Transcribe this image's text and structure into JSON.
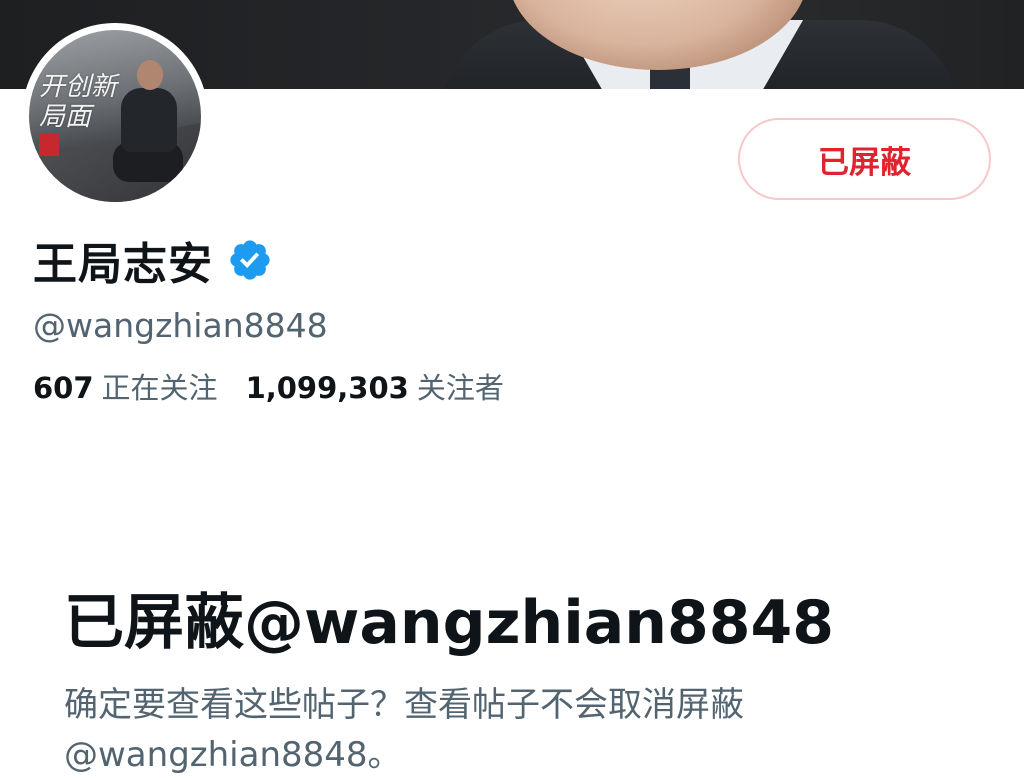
{
  "profile": {
    "display_name": "王局志安",
    "handle": "@wangzhian8848",
    "verified_icon": "verified-badge-icon",
    "avatar_text": "开创新局面",
    "blocked_button_label": "已屏蔽",
    "following_count": "607",
    "following_label": "正在关注",
    "followers_count": "1,099,303",
    "followers_label": "关注者"
  },
  "notice": {
    "title": "已屏蔽@wangzhian8848",
    "body": "确定要查看这些帖子？查看帖子不会取消屏蔽@wangzhian8848。"
  },
  "colors": {
    "accent_blocked": "#e0242f",
    "verified_blue": "#1d9bf0",
    "text_primary": "#0f1419",
    "text_secondary": "#536471"
  }
}
